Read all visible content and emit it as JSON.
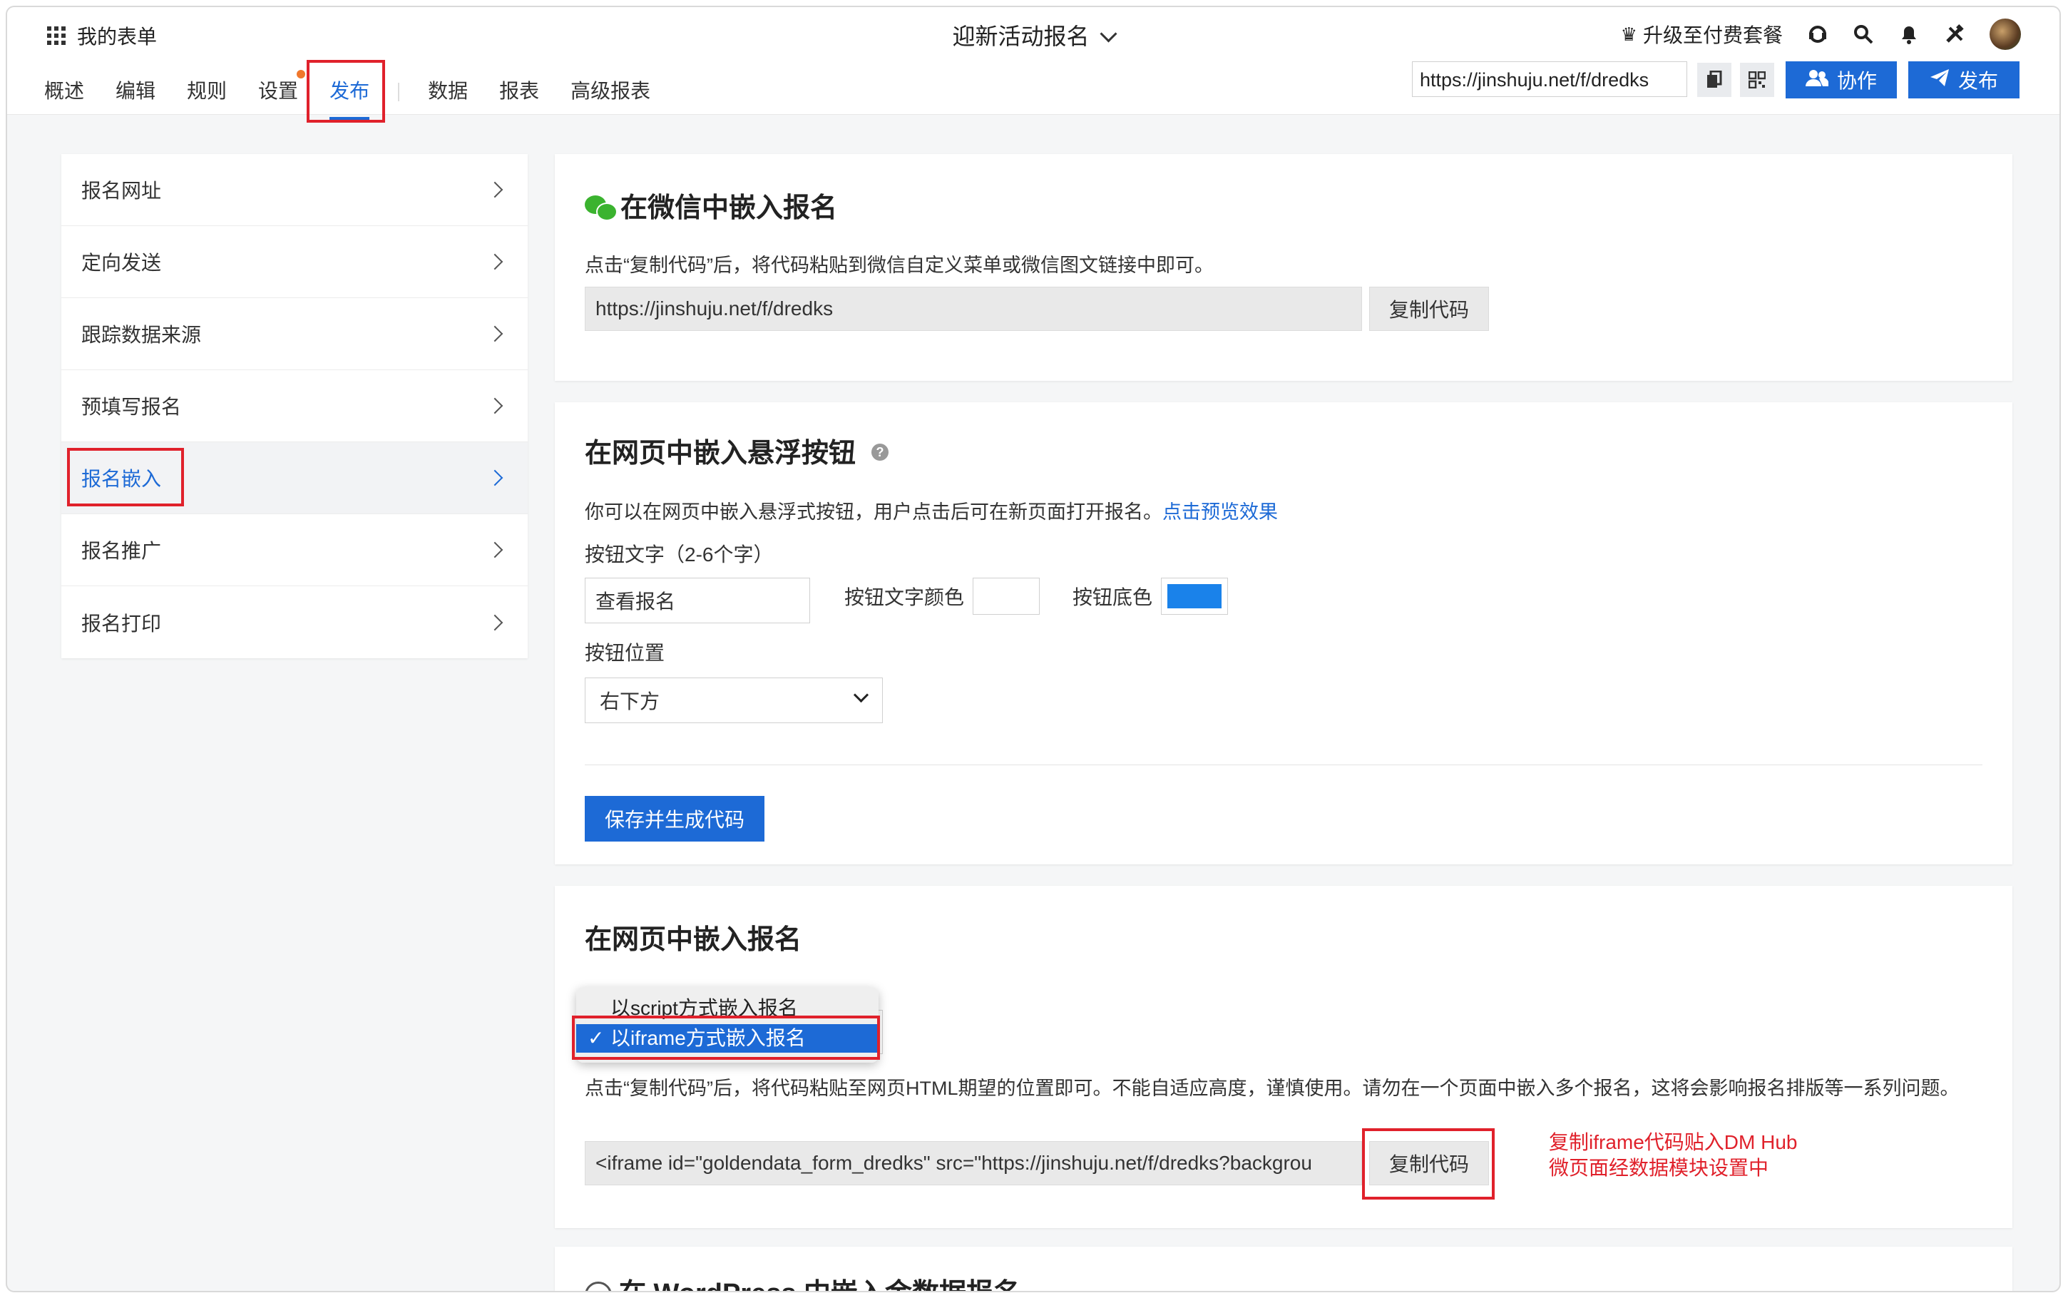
{
  "header": {
    "apps_label": "我的表单",
    "form_title": "迎新活动报名",
    "upgrade_label": "升级至付费套餐",
    "tabs": [
      "概述",
      "编辑",
      "规则",
      "设置",
      "发布",
      "数据",
      "报表",
      "高级报表"
    ],
    "active_tab": "发布",
    "form_url": "https://jinshuju.net/f/dredks",
    "collaborate_label": "协作",
    "publish_label": "发布"
  },
  "sidebar": {
    "items": [
      {
        "label": "报名网址"
      },
      {
        "label": "定向发送"
      },
      {
        "label": "跟踪数据来源"
      },
      {
        "label": "预填写报名"
      },
      {
        "label": "报名嵌入"
      },
      {
        "label": "报名推广"
      },
      {
        "label": "报名打印"
      }
    ],
    "selected": "报名嵌入"
  },
  "wechat": {
    "title": "在微信中嵌入报名",
    "desc": "点击“复制代码”后，将代码粘贴到微信自定义菜单或微信图文链接中即可。",
    "code": "https://jinshuju.net/f/dredks",
    "copy_label": "复制代码"
  },
  "floating": {
    "title": "在网页中嵌入悬浮按钮",
    "help": "?",
    "desc": "你可以在网页中嵌入悬浮式按钮，用户点击后可在新页面打开报名。",
    "preview_link": "点击预览效果",
    "btn_text_label": "按钮文字（2-6个字）",
    "btn_text_value": "查看报名",
    "text_color_label": "按钮文字颜色",
    "text_color": "#ffffff",
    "bg_color_label": "按钮底色",
    "bg_color": "#1a82ea",
    "position_label": "按钮位置",
    "position_value": "右下方",
    "save_label": "保存并生成代码"
  },
  "embed": {
    "title": "在网页中嵌入报名",
    "options": [
      "以script方式嵌入报名",
      "以iframe方式嵌入报名"
    ],
    "selected_option": "以iframe方式嵌入报名",
    "check": "✓",
    "desc": "点击“复制代码”后，将代码粘贴至网页HTML期望的位置即可。不能自适应高度，谨慎使用。请勿在一个页面中嵌入多个报名，这将会影响报名排版等一系列问题。",
    "code": "<iframe id=\"goldendata_form_dredks\" src=\"https://jinshuju.net/f/dredks?backgrou",
    "copy_label": "复制代码",
    "annotation_line1": "复制iframe代码贴入DM Hub",
    "annotation_line2": "微页面经数据模块设置中"
  },
  "wordpress": {
    "title": "在 WordPress 中嵌入金数据报名"
  },
  "colors": {
    "accent": "#1d6ad6",
    "highlight_box": "#e0212b",
    "badge_dot": "#f0772c"
  }
}
